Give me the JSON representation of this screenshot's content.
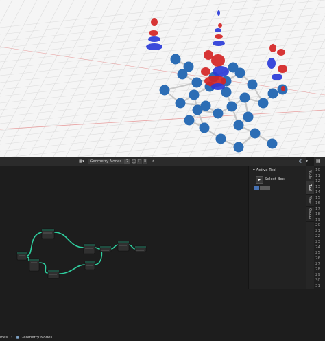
{
  "node_editor_header": {
    "tree_name": "Geometry Nodes",
    "user_count": "2"
  },
  "breadcrumb": {
    "parent": "ides",
    "separator": "›",
    "current": "Geometry Nodes"
  },
  "side_panel": {
    "title": "Active Tool",
    "tool_label": "Select Box"
  },
  "tabs": [
    "Node",
    "Tool",
    "View",
    "Group"
  ],
  "line_numbers": [
    "10",
    "11",
    "12",
    "13",
    "14",
    "15",
    "16",
    "17",
    "18",
    "19",
    "20",
    "21",
    "22",
    "23",
    "24",
    "25",
    "26",
    "27",
    "28",
    "29",
    "30",
    "31"
  ],
  "colors": {
    "viewport_bg": "#f5f5f5",
    "grid": "#dcdcdc",
    "x_axis": "#e8a0a0",
    "atom": "#2c6db5",
    "bond": "#c8c8c8",
    "orbital_pos": "#d42424",
    "orbital_neg": "#2a3bd8",
    "node_link": "#2fd0a0",
    "accent": "#4772b3"
  }
}
